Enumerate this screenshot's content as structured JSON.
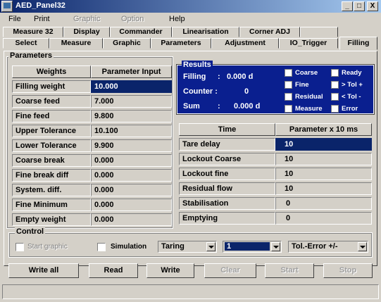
{
  "window": {
    "title": "AED_Panel32",
    "minimize": "_",
    "maximize": "□",
    "close": "X"
  },
  "menu": {
    "file": "File",
    "print": "Print",
    "graphic": "Graphic",
    "option": "Option",
    "help": "Help"
  },
  "tabs_row1": [
    "Measure 32",
    "Display",
    "Commander",
    "Linearisation",
    "Corner ADJ"
  ],
  "tabs_row2": [
    "Select",
    "Measure",
    "Graphic",
    "Parameters",
    "Adjustment",
    "IO_Trigger",
    "Filling"
  ],
  "parameters": {
    "label": "Parameters",
    "header_name": "Weights",
    "header_value": "Parameter Input",
    "rows": [
      {
        "name": "Filling weight",
        "value": "10.000"
      },
      {
        "name": "Coarse feed",
        "value": "7.000"
      },
      {
        "name": "Fine feed",
        "value": "9.800"
      },
      {
        "name": "Upper Tolerance",
        "value": "10.100"
      },
      {
        "name": "Lower Tolerance",
        "value": "9.900"
      },
      {
        "name": "Coarse break",
        "value": "0.000"
      },
      {
        "name": "Fine break diff",
        "value": "0.000"
      },
      {
        "name": "System. diff.",
        "value": "0.000"
      },
      {
        "name": "Fine Minimum",
        "value": "0.000"
      },
      {
        "name": "Empty weight",
        "value": "0.000"
      }
    ]
  },
  "results": {
    "label": "Results",
    "filling_label": "Filling",
    "filling_sep": ":",
    "filling_value": "0.000 d",
    "counter_label": "Counter :",
    "counter_value": "0",
    "sum_label": "Sum",
    "sum_sep": ":",
    "sum_value": "0.000  d",
    "flags": [
      "Coarse",
      "Fine",
      "Residual",
      "Measure",
      "Ready",
      "> Tol +",
      "< Tol -",
      "Error"
    ]
  },
  "time_table": {
    "header_name": "Time",
    "header_value": "Parameter x 10 ms",
    "rows": [
      {
        "name": "Tare delay",
        "value": "10"
      },
      {
        "name": "Lockout Coarse",
        "value": "10"
      },
      {
        "name": "Lockout fine",
        "value": "10"
      },
      {
        "name": "Residual flow",
        "value": "10"
      },
      {
        "name": "Stabilisation",
        "value": "0"
      },
      {
        "name": "Emptying",
        "value": "0"
      }
    ]
  },
  "control": {
    "label": "Control",
    "start_graphic": "Start graphic",
    "simulation": "Simulation",
    "mode_combo": "Taring",
    "channel_combo": "1",
    "tol_combo": "Tol.-Error +/-"
  },
  "buttons": {
    "write_all": "Write all",
    "read": "Read",
    "write": "Write",
    "clear": "Clear",
    "start": "Start",
    "stop": "Stop"
  }
}
